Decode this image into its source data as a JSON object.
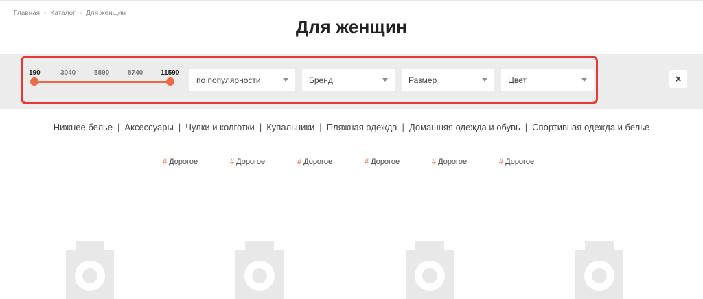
{
  "breadcrumb": [
    "Главная",
    "Каталог",
    "Для женщин"
  ],
  "breadcrumb_separator": "-",
  "title": "Для женщин",
  "price_filter": {
    "ticks": [
      "190",
      "3040",
      "5890",
      "8740",
      "11590"
    ],
    "min_value": 190,
    "max_value": 11590,
    "selected_min": 190,
    "selected_max": 11590
  },
  "filters": {
    "sort": "по популярности",
    "brand": "Бренд",
    "size": "Размер",
    "color": "Цвет"
  },
  "close_label": "×",
  "categories": [
    "Нижнее белье",
    "Аксессуары",
    "Чулки и колготки",
    "Купальники",
    "Пляжная одежда",
    "Домашняя одежда и обувь",
    "Спортивная одежда и белье"
  ],
  "category_separator": "|",
  "tag_hash": "#",
  "tags": [
    "Дорогое",
    "Дорогое",
    "Дорогое",
    "Дорогое",
    "Дорогое",
    "Дорогое"
  ],
  "colors": {
    "accent": "#ee6a47",
    "highlight_border": "#e53935",
    "filter_band": "#ececec",
    "placeholder": "#e8e8e8"
  },
  "product_placeholders": [
    {
      "icon": "camera-icon"
    },
    {
      "icon": "camera-icon"
    },
    {
      "icon": "camera-icon"
    },
    {
      "icon": "camera-icon"
    }
  ]
}
